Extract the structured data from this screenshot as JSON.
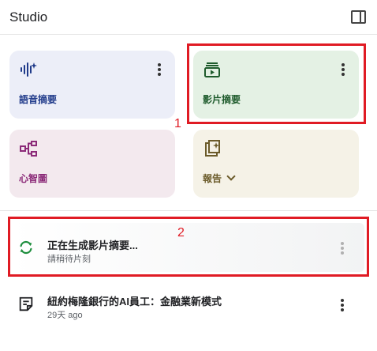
{
  "header": {
    "title": "Studio",
    "panel_icon": "side-panel-icon"
  },
  "cards": [
    {
      "label": "語音摘要",
      "icon": "audio-waveform-icon",
      "color": "#1f3a8a"
    },
    {
      "label": "影片摘要",
      "icon": "video-summary-icon",
      "color": "#1e5b2c"
    },
    {
      "label": "心智圖",
      "icon": "mind-map-icon",
      "color": "#8b2a78"
    },
    {
      "label": "報告",
      "icon": "report-icon",
      "color": "#6b5b2a"
    }
  ],
  "annotations": {
    "one": "1",
    "two": "2"
  },
  "list": [
    {
      "title": "正在生成影片摘要...",
      "subtitle": "請稍待片刻",
      "icon": "sync-icon"
    },
    {
      "title": "紐約梅隆銀行的AI員工：金融業新模式",
      "subtitle": "29天 ago",
      "icon": "note-icon"
    }
  ],
  "accent": "#e01b24"
}
